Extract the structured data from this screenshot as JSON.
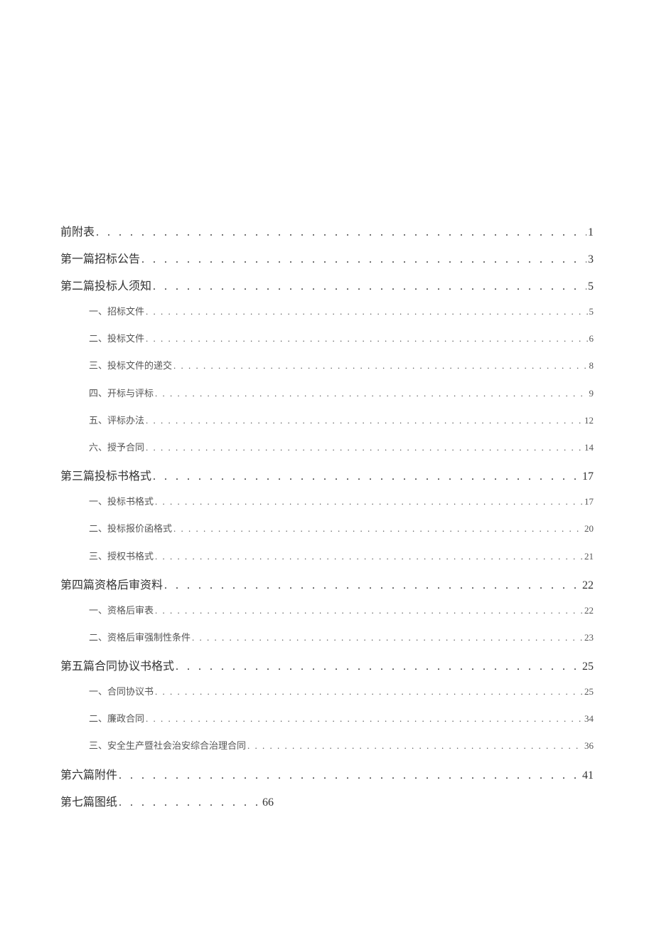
{
  "toc": [
    {
      "level": 1,
      "label": "前附表",
      "page": "1"
    },
    {
      "level": 1,
      "label": "第一篇招标公告",
      "page": "3"
    },
    {
      "level": 1,
      "label": "第二篇投标人须知",
      "page": "5"
    },
    {
      "level": 2,
      "label": "一、招标文件",
      "page": "5"
    },
    {
      "level": 2,
      "label": "二、投标文件",
      "page": "6"
    },
    {
      "level": 2,
      "label": "三、投标文件的递交",
      "page": "8"
    },
    {
      "level": 2,
      "label": "四、开标与评标",
      "page": "9"
    },
    {
      "level": 2,
      "label": "五、评标办法",
      "page": "12"
    },
    {
      "level": 2,
      "label": "六、授予合同",
      "page": "14"
    },
    {
      "level": 1,
      "label": "第三篇投标书格式",
      "page": "17"
    },
    {
      "level": 2,
      "label": "一、投标书格式",
      "page": "17"
    },
    {
      "level": 2,
      "label": "二、投标报价函格式",
      "page": "20"
    },
    {
      "level": 2,
      "label": "三、授权书格式",
      "page": "21"
    },
    {
      "level": 1,
      "label": "第四篇资格后审资料",
      "page": "22"
    },
    {
      "level": 2,
      "label": "一、资格后审表",
      "page": "22"
    },
    {
      "level": 2,
      "label": "二、资格后审强制性条件",
      "page": "23"
    },
    {
      "level": 1,
      "label": "第五篇合同协议书格式",
      "page": "25"
    },
    {
      "level": 2,
      "label": "一、合同协议书",
      "page": "25"
    },
    {
      "level": 2,
      "label": "二、廉政合同",
      "page": "34"
    },
    {
      "level": 2,
      "label": "三、安全生产暨社会治安综合治理合同",
      "page": "36"
    },
    {
      "level": 1,
      "label": "第六篇附件",
      "page": "41"
    },
    {
      "level": 1,
      "label": "第七篇图纸",
      "page": "66",
      "short_leader": true
    }
  ]
}
